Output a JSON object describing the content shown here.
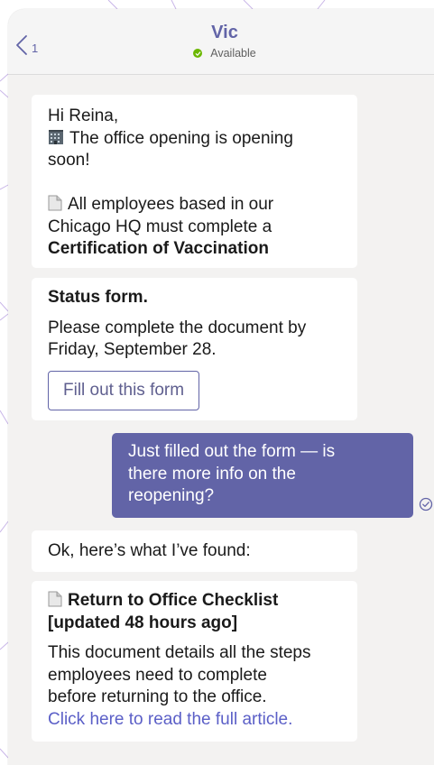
{
  "header": {
    "back_count": "1",
    "contact_name": "Vic",
    "presence": "Available"
  },
  "messages": {
    "m1": {
      "greeting": "Hi Reina,",
      "line1a": "The office opening is opening",
      "line1b": "soon!",
      "line2a": "All employees based in our",
      "line2b": "Chicago HQ must complete a",
      "line2c": "Certification of Vaccination"
    },
    "m2": {
      "title": "Status form.",
      "line1": "Please complete the document by",
      "line2": "Friday, September 28.",
      "button_label": "Fill out this form"
    },
    "m3": {
      "line1": "Just filled out the form — is",
      "line2": "there more info on the",
      "line3": "reopening?"
    },
    "m4": {
      "text": "Ok, here’s what I’ve found:"
    },
    "m5": {
      "title1": "Return to Office Checklist",
      "title2": "[updated 48 hours ago]",
      "line1": "This document details all the steps",
      "line2": "employees need to complete",
      "line3": "before returning to the office.",
      "link": "Click here to read the full article."
    }
  },
  "icons": {
    "back": "chevron-left-icon",
    "presence": "checkmark-icon",
    "building": "office-building-icon",
    "document": "document-icon",
    "read_receipt": "read-receipt-icon"
  },
  "colors": {
    "brand": "#6264a7",
    "presence_green": "#6bb700",
    "link": "#5b5fc7",
    "chat_background": "#f3f2f1"
  }
}
